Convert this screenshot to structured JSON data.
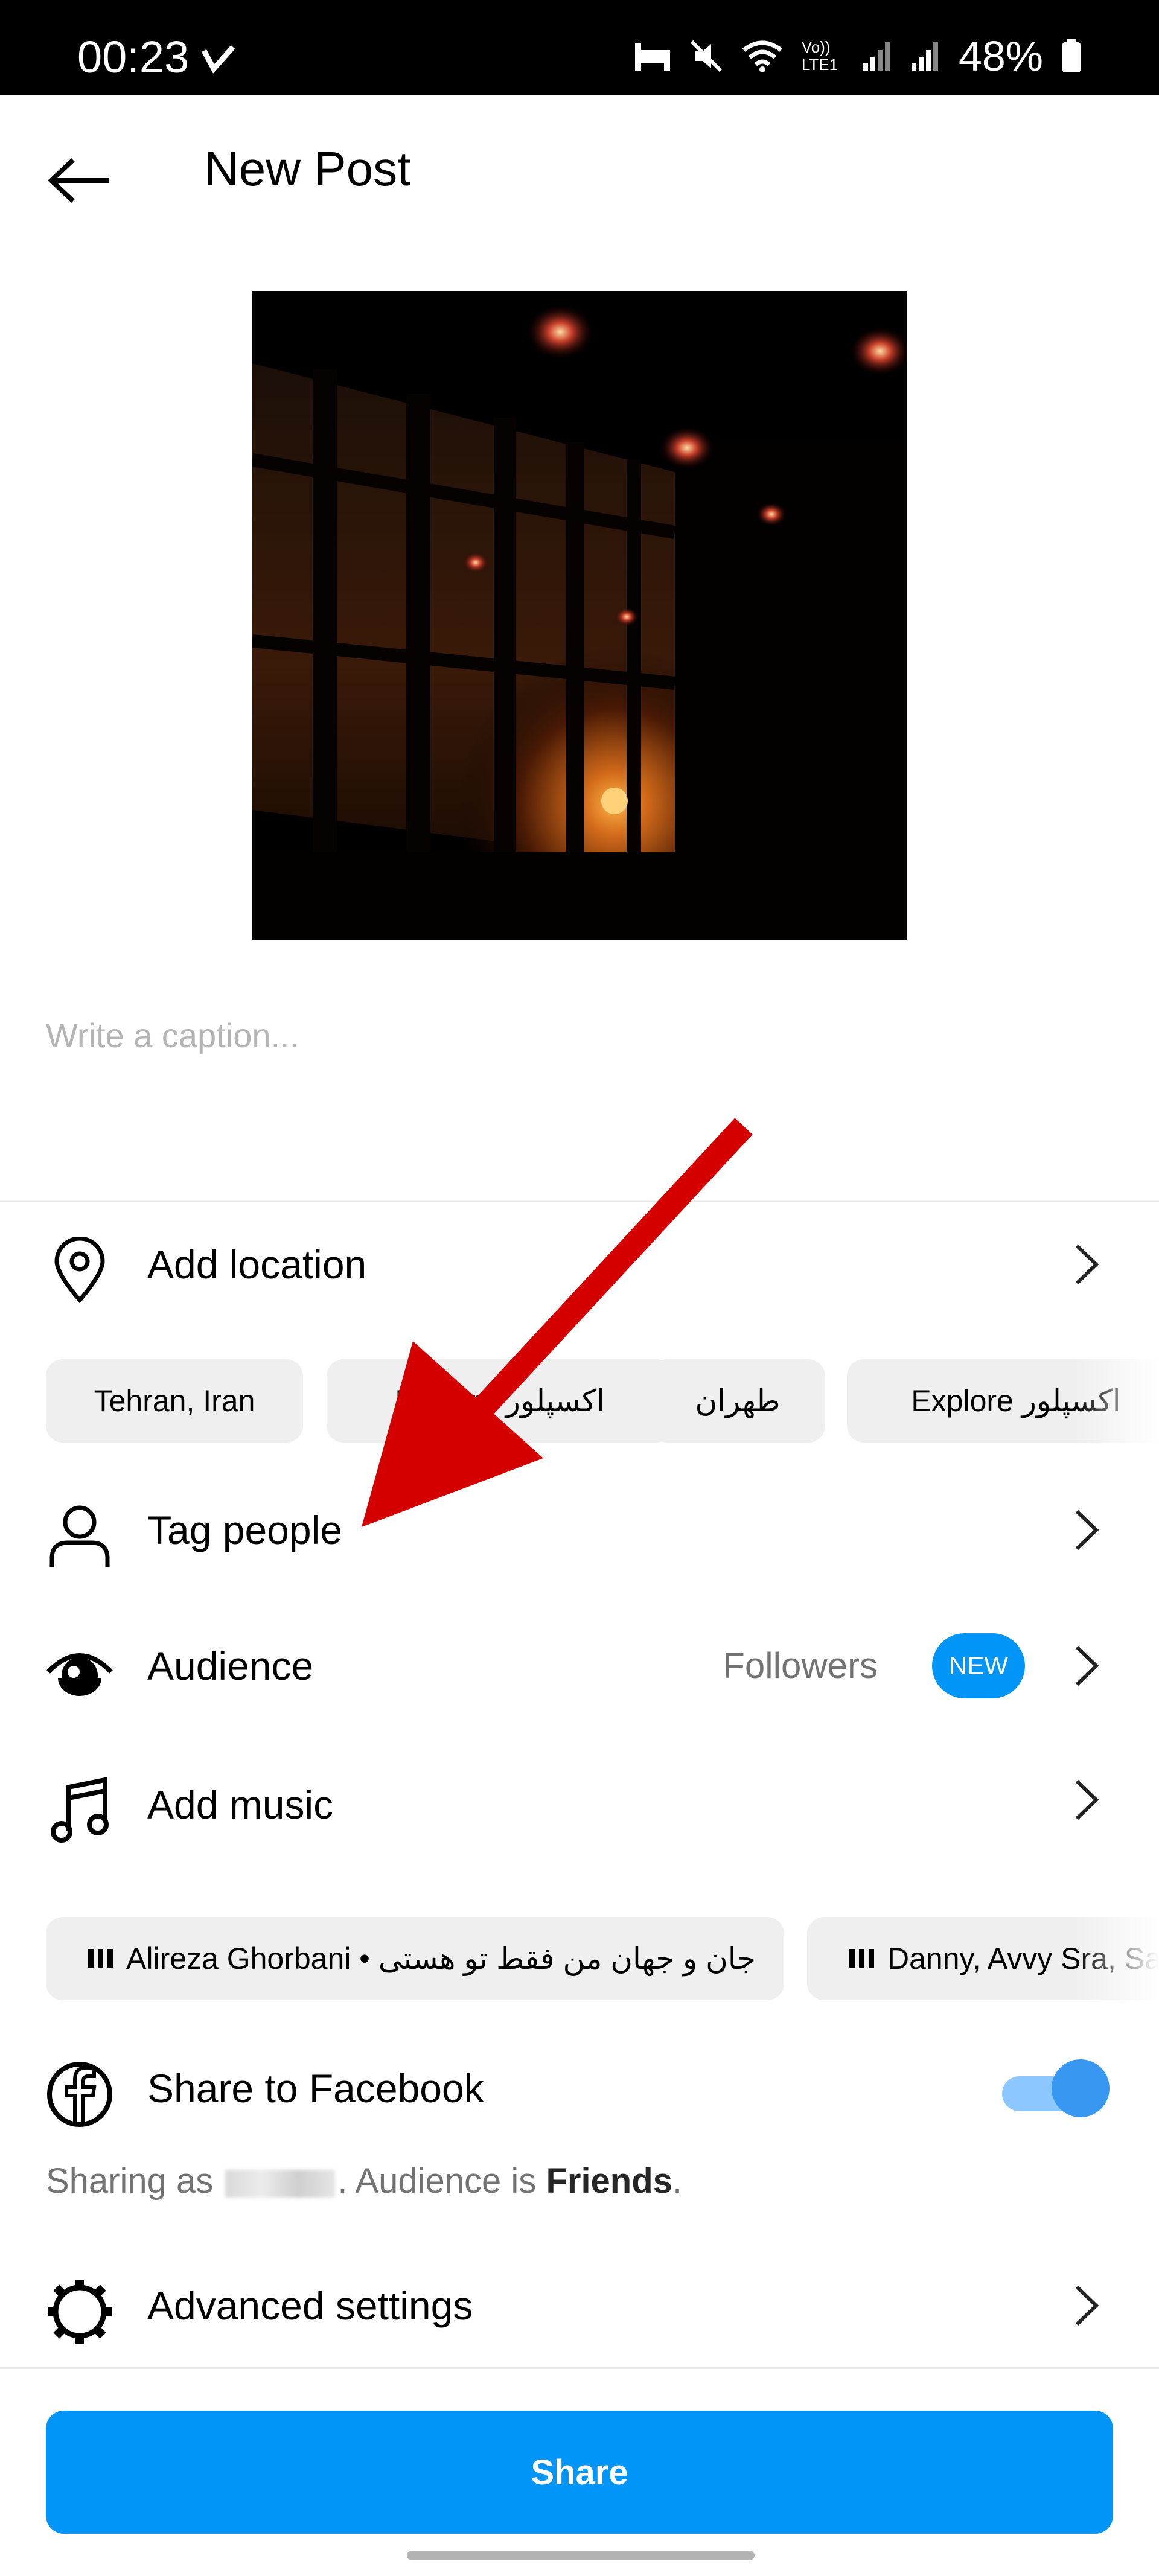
{
  "status_bar": {
    "time": "00:23",
    "network_label": "Vo)) LTE1",
    "battery": "48%"
  },
  "header": {
    "title": "New Post",
    "back_icon": "arrow-left-icon"
  },
  "caption": {
    "placeholder": "Write a caption..."
  },
  "location": {
    "label": "Add location",
    "suggestions": [
      "Tehran, Iran",
      "Explore اکسپلور",
      "طهران",
      "Explore اکسپلور"
    ]
  },
  "tag_people": {
    "label": "Tag people"
  },
  "audience": {
    "label": "Audience",
    "value": "Followers",
    "badge": "NEW"
  },
  "music": {
    "label": "Add music",
    "suggestions": [
      "Alireza Ghorbani • جان و جهان من فقط تو هستی",
      "Danny, Avvy Sra, Sa"
    ]
  },
  "facebook": {
    "label": "Share to Facebook",
    "enabled": true,
    "sharing_prefix": "Sharing as",
    "sharing_middle": ". Audience is",
    "audience": "Friends",
    "sharing_suffix": "."
  },
  "advanced": {
    "label": "Advanced settings"
  },
  "share_button": {
    "label": "Share"
  },
  "colors": {
    "accent": "#0095f6",
    "annotation_arrow": "#d40000"
  }
}
